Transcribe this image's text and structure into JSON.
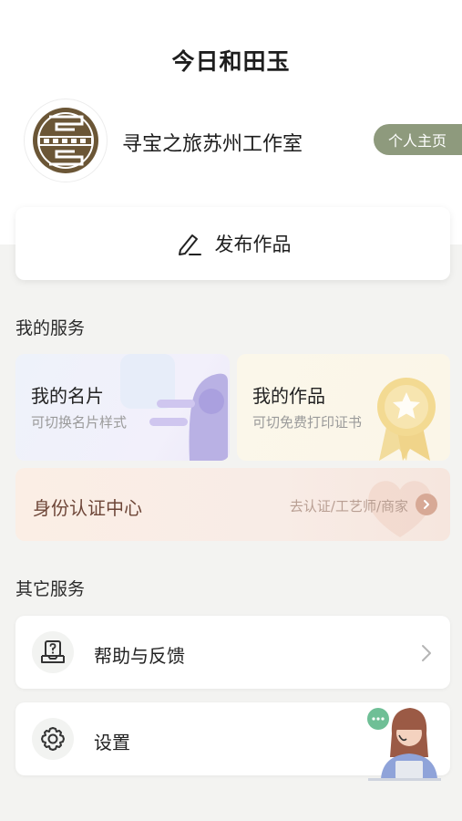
{
  "header": {
    "title": "今日和田玉"
  },
  "profile": {
    "studio_name": "寻宝之旅苏州工作室",
    "home_button_label": "个人主页",
    "avatar_icon": "seal-logo-icon"
  },
  "publish": {
    "label": "发布作品",
    "icon": "pen-icon"
  },
  "my_services": {
    "title": "我的服务",
    "cards": [
      {
        "title": "我的名片",
        "subtitle": "可切换名片样式",
        "icon": "card-person-icon"
      },
      {
        "title": "我的作品",
        "subtitle": "可切免费打印证书",
        "icon": "star-medal-icon"
      }
    ],
    "identity": {
      "title": "身份认证中心",
      "link": "去认证/工艺师/商家",
      "icon": "chevron-right-icon"
    }
  },
  "other_services": {
    "title": "其它服务",
    "items": [
      {
        "label": "帮助与反馈",
        "icon": "help-feedback-icon"
      },
      {
        "label": "设置",
        "icon": "gear-icon"
      }
    ]
  },
  "colors": {
    "accent_green": "#8e9a7d",
    "identity_text": "#6e4638",
    "background": "#f3f3f1"
  }
}
